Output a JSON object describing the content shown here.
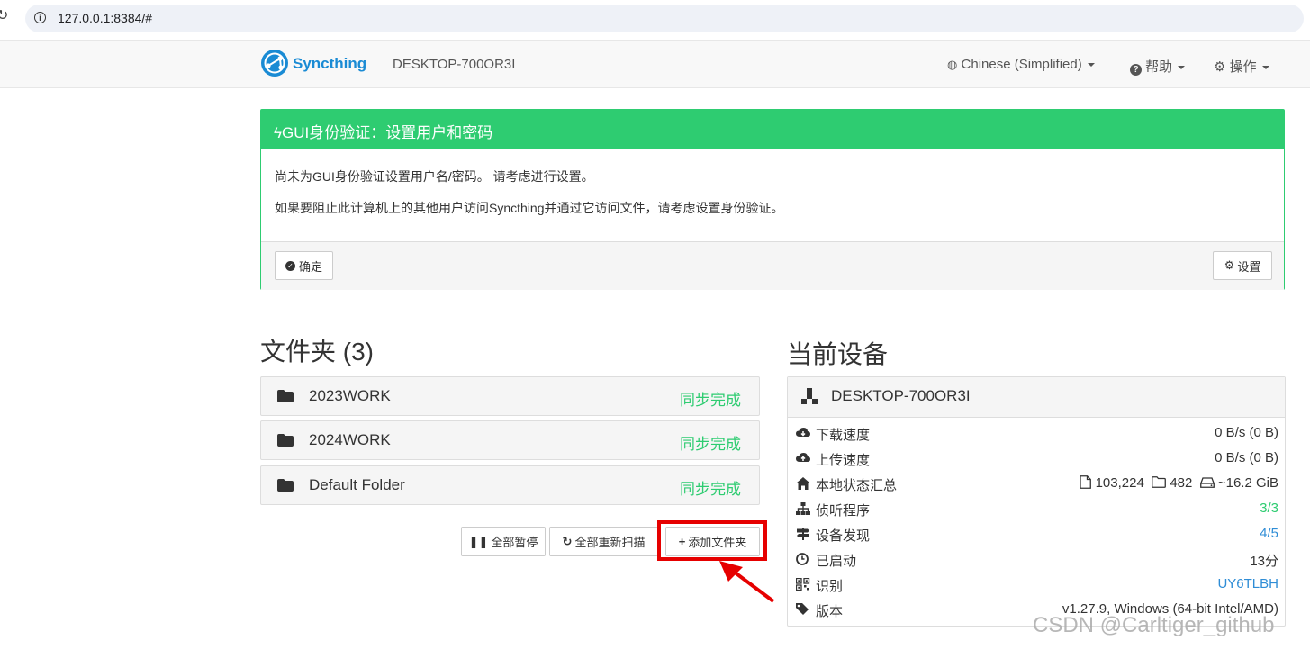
{
  "browser": {
    "url": "127.0.0.1:8384/#"
  },
  "navbar": {
    "logo_text": "Syncthing",
    "device_name": "DESKTOP-700OR3I",
    "language": "Chinese (Simplified)",
    "help": "帮助",
    "actions": "操作"
  },
  "alert": {
    "title": "GUI身份验证：设置用户和密码",
    "line1": "尚未为GUI身份验证设置用户名/密码。 请考虑进行设置。",
    "line2": "如果要阻止此计算机上的其他用户访问Syncthing并通过它访问文件，请考虑设置身份验证。",
    "ok_label": "确定",
    "settings_label": "设置"
  },
  "folders": {
    "title": "文件夹 (3)",
    "items": [
      {
        "name": "2023WORK",
        "status": "同步完成"
      },
      {
        "name": "2024WORK",
        "status": "同步完成"
      },
      {
        "name": "Default Folder",
        "status": "同步完成"
      }
    ],
    "pause_all": "全部暂停",
    "rescan_all": "全部重新扫描",
    "add_folder": "添加文件夹"
  },
  "device": {
    "title": "当前设备",
    "name": "DESKTOP-700OR3I",
    "rows": [
      {
        "label": "下载速度",
        "value": "0 B/s (0 B)"
      },
      {
        "label": "上传速度",
        "value": "0 B/s (0 B)"
      },
      {
        "label": "本地状态汇总",
        "files": "103,224",
        "dirs": "482",
        "size": "~16.2 GiB"
      },
      {
        "label": "侦听程序",
        "value": "3/3"
      },
      {
        "label": "设备发现",
        "value": "4/5"
      },
      {
        "label": "已启动",
        "value": "13分"
      },
      {
        "label": "识别",
        "value": "UY6TLBH"
      },
      {
        "label": "版本",
        "value": "v1.27.9, Windows (64-bit Intel/AMD)"
      }
    ]
  },
  "watermark": "CSDN @Carltiger_github",
  "colors": {
    "accent": "#2ecc71",
    "brand": "#1a8bd4",
    "link": "#2f8dd6",
    "highlight": "#e60000"
  }
}
